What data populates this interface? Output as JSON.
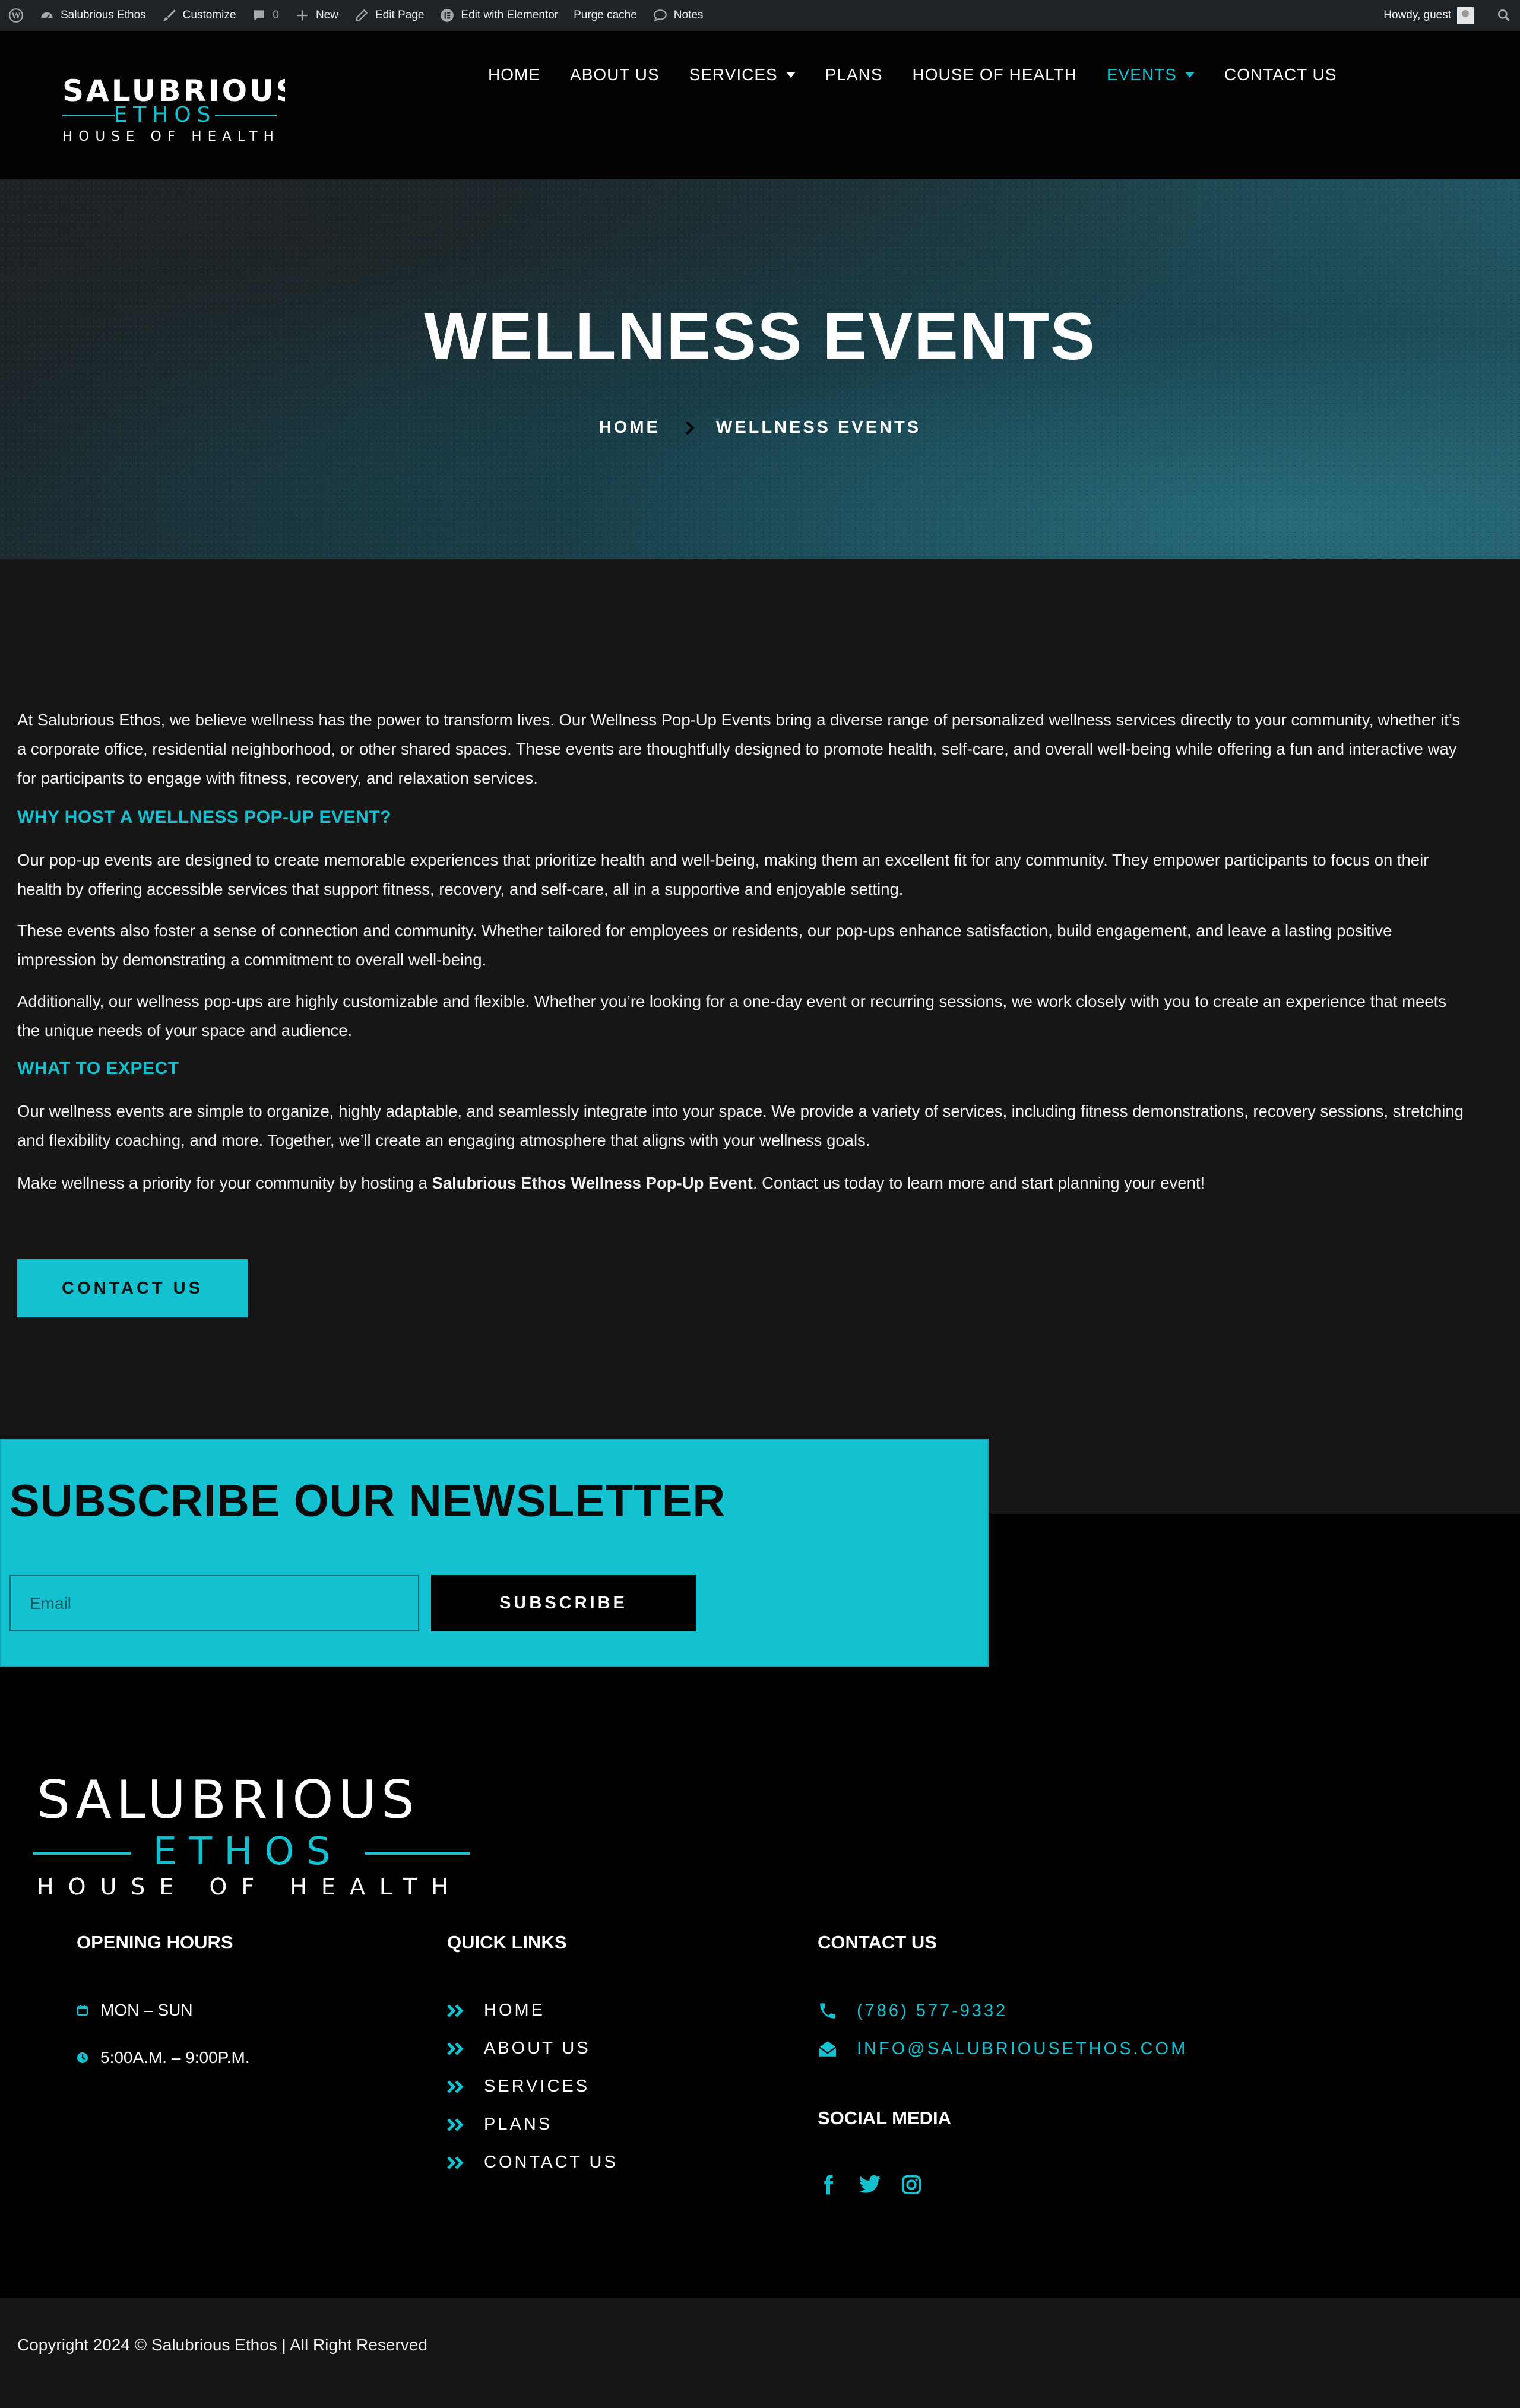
{
  "admin_bar": {
    "site_name": "Salubrious Ethos",
    "customize": "Customize",
    "comments_count": "0",
    "new": "New",
    "edit_page": "Edit Page",
    "edit_elementor": "Edit with Elementor",
    "purge_cache": "Purge cache",
    "notes": "Notes",
    "howdy": "Howdy, guest"
  },
  "logo": {
    "line1": "SALUBRIOUS",
    "line2": "ETHOS",
    "line3": "HOUSE OF HEALTH"
  },
  "nav": {
    "items": [
      "HOME",
      "ABOUT US",
      "SERVICES",
      "PLANS",
      "HOUSE OF HEALTH",
      "EVENTS",
      "CONTACT US"
    ],
    "active": "EVENTS"
  },
  "hero": {
    "title": "WELLNESS EVENTS",
    "breadcrumb_home": "HOME",
    "breadcrumb_current": "WELLNESS EVENTS"
  },
  "content": {
    "intro": "At Salubrious Ethos, we believe wellness has the power to transform lives. Our Wellness Pop-Up Events bring a diverse range of personalized wellness services directly to your community, whether it’s a corporate office, residential neighborhood, or other shared spaces. These events are thoughtfully designed to promote health, self-care, and overall well-being while offering a fun and interactive way for participants to engage with fitness, recovery, and relaxation services.",
    "heading_why": "WHY HOST A WELLNESS POP-UP EVENT?",
    "why_p1": "Our pop-up events are designed to create memorable experiences that prioritize health and well-being, making them an excellent fit for any community. They empower participants to focus on their health by offering accessible services that support fitness, recovery, and self-care, all in a supportive and enjoyable setting.",
    "why_p2": "These events also foster a sense of connection and community. Whether tailored for employees or residents, our pop-ups enhance satisfaction, build engagement, and leave a lasting positive impression by demonstrating a commitment to overall well-being.",
    "why_p3": "Additionally, our wellness pop-ups are highly customizable and flexible. Whether you’re looking for a one-day event or recurring sessions, we work closely with you to create an experience that meets the unique needs of your space and audience.",
    "heading_expect": "WHAT TO EXPECT",
    "expect_p1": "Our wellness events are simple to organize, highly adaptable, and seamlessly integrate into your space. We provide a variety of services, including fitness demonstrations, recovery sessions, stretching and flexibility coaching, and more. Together, we’ll create an engaging atmosphere that aligns with your wellness goals.",
    "closing_before": "Make wellness a priority for your community by hosting a ",
    "closing_bold": "Salubrious Ethos Wellness Pop-Up Event",
    "closing_after": ". Contact us today to learn more and start planning your event!",
    "contact_button": "CONTACT US"
  },
  "newsletter": {
    "title": "SUBSCRIBE OUR NEWSLETTER",
    "email_placeholder": "Email",
    "button": "SUBSCRIBE"
  },
  "footer": {
    "hours_title": "OPENING HOURS",
    "hours_days": "MON – SUN",
    "hours_time": "5:00A.M. – 9:00P.M.",
    "quick_links_title": "QUICK LINKS",
    "quick_links": [
      "HOME",
      "ABOUT US",
      "SERVICES",
      "PLANS",
      "CONTACT US"
    ],
    "contact_title": "CONTACT US",
    "phone": "(786) 577-9332",
    "email": "INFO@SALUBRIOUSETHOS.COM",
    "social_title": "SOCIAL MEDIA",
    "social_icons": [
      "facebook-icon",
      "twitter-icon",
      "instagram-icon"
    ],
    "copyright": "Copyright 2024 © Salubrious Ethos | All Right Reserved"
  },
  "colors": {
    "accent": "#14c1d0",
    "dark": "#161616",
    "black": "#000000",
    "admin_bar": "#1d2327"
  }
}
